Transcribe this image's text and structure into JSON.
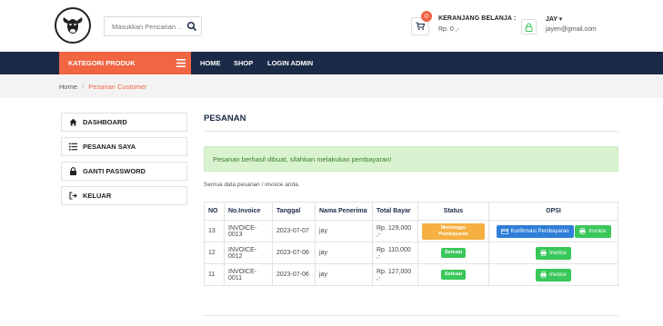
{
  "header": {
    "search_placeholder": "Masukkan Pencarian ..",
    "cart": {
      "badge": "0",
      "title": "KERANJANG BELANJA :",
      "amount": "Rp. 0 ,-"
    },
    "user": {
      "name": "JAY ▾",
      "email": "jayen@gmail.com"
    }
  },
  "nav": {
    "kategori": "KATEGORI PRODUK",
    "links": [
      "HOME",
      "SHOP",
      "LOGIN ADMIN"
    ]
  },
  "breadcrumb": {
    "home": "Home",
    "sep": "/",
    "current": "Pesanan Customer"
  },
  "sidebar": {
    "items": [
      {
        "label": "DASHBOARD",
        "icon": "home-icon"
      },
      {
        "label": "PESANAN SAYA",
        "icon": "list-icon"
      },
      {
        "label": "GANTI PASSWORD",
        "icon": "lock-icon"
      },
      {
        "label": "KELUAR",
        "icon": "sign-out-icon"
      }
    ]
  },
  "main": {
    "title": "PESANAN",
    "alert": "Pesanan berhasil dibuat, silahkan melakukan pembayaran!",
    "note": "Semua data pesanan / invoice anda.",
    "columns": [
      "NO",
      "No.Invoice",
      "Tanggal",
      "Nama Penerima",
      "Total Bayar",
      "Status",
      "OPSI"
    ],
    "rows": [
      {
        "no": "13",
        "invoice": "INVOICE-0013",
        "tanggal": "2023-07-07",
        "nama": "jay",
        "total": "Rp. 129,000 ,-",
        "status": "Menunggu Pembayaran",
        "status_type": "warning",
        "confirm": "Konfirmasi Pembayaran",
        "invoice_btn": "Invoice"
      },
      {
        "no": "12",
        "invoice": "INVOICE-0012",
        "tanggal": "2023-07-06",
        "nama": "jay",
        "total": "Rp. 110,000 ,-",
        "status": "Selesai",
        "status_type": "success",
        "invoice_btn": "Invoice"
      },
      {
        "no": "11",
        "invoice": "INVOICE-0011",
        "tanggal": "2023-07-06",
        "nama": "jay",
        "total": "Rp. 127,000 ,-",
        "status": "Selesai",
        "status_type": "success",
        "invoice_btn": "Invoice"
      }
    ]
  },
  "colors": {
    "navy": "#1b2a47",
    "accent": "#f16543",
    "alert_bg": "#d9f3d0",
    "warning": "#f5b041",
    "success": "#39c75a",
    "primary": "#2f7ed8"
  }
}
